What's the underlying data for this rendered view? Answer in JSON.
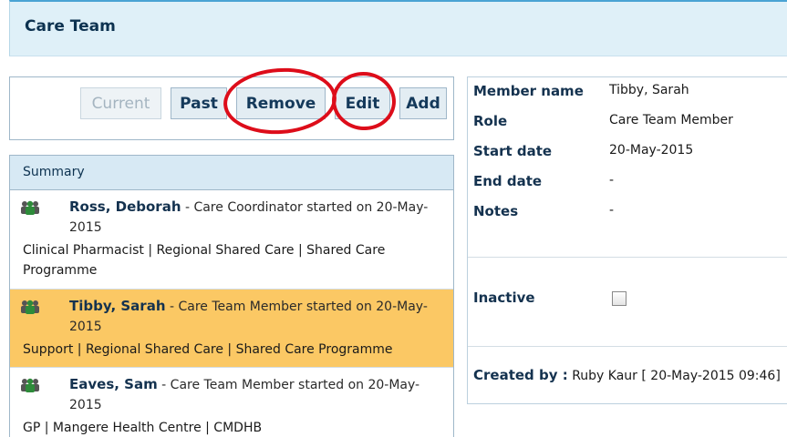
{
  "header": {
    "title": "Care Team"
  },
  "toolbar": {
    "current_label": "Current",
    "past_label": "Past",
    "remove_label": "Remove",
    "edit_label": "Edit",
    "add_label": "Add"
  },
  "summary": {
    "heading": "Summary",
    "items": [
      {
        "name": "Ross, Deborah",
        "desc": " - Care Coordinator started on 20-May-2015",
        "detail": "Clinical Pharmacist | Regional Shared Care | Shared Care Programme",
        "selected": false,
        "icon": "care-team-people-icon"
      },
      {
        "name": "Tibby, Sarah",
        "desc": " - Care Team Member started on 20-May-2015",
        "detail": "Support | Regional Shared Care | Shared Care Programme",
        "selected": true,
        "icon": "care-team-people-icon"
      },
      {
        "name": "Eaves, Sam",
        "desc": " - Care Team Member started on 20-May-2015",
        "detail": "GP | Mangere Health Centre | CMDHB",
        "selected": false,
        "icon": "care-team-people-icon"
      }
    ]
  },
  "details": {
    "member_name_label": "Member name",
    "member_name_value": "Tibby, Sarah",
    "role_label": "Role",
    "role_value": "Care Team Member",
    "start_date_label": "Start date",
    "start_date_value": "20-May-2015",
    "end_date_label": "End date",
    "end_date_value": "-",
    "notes_label": "Notes",
    "notes_value": "-",
    "inactive_label": "Inactive",
    "inactive_checked": false,
    "created_by_label": "Created by :",
    "created_by_value": " Ruby Kaur [ 20-May-2015 09:46]"
  },
  "colors": {
    "header_bg": "#dff0f8",
    "selected_row": "#fbc864",
    "annotation_circle": "#dd0d1a",
    "icon_green": "#2e8b3a"
  }
}
